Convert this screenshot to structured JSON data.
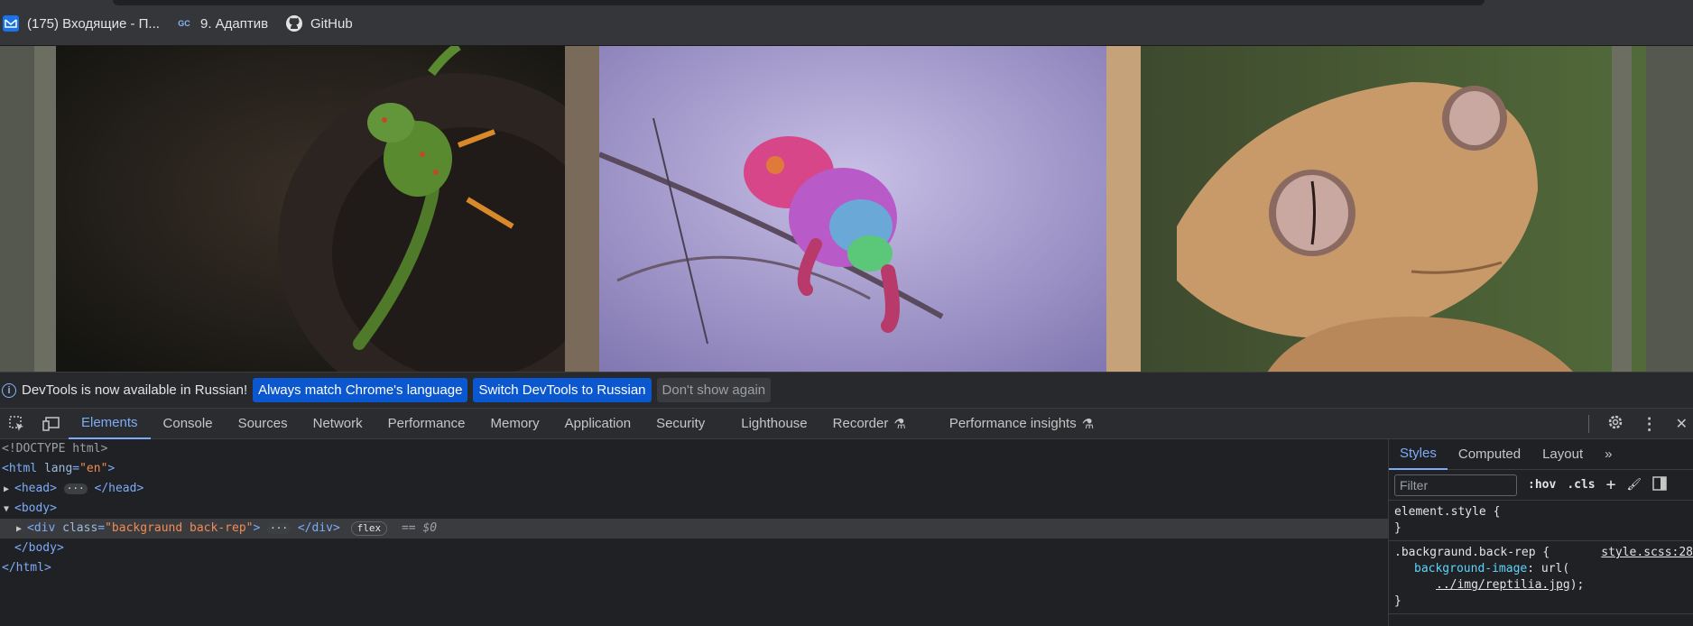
{
  "bookmarks": [
    {
      "label": "(175) Входящие - П...",
      "icon": "mail-icon"
    },
    {
      "label": "9. Адаптив",
      "icon": "gc-icon",
      "icon_text": "GC"
    },
    {
      "label": "GitHub",
      "icon": "github-icon"
    }
  ],
  "infobar": {
    "message": "DevTools is now available in Russian!",
    "btn_match": "Always match Chrome's language",
    "btn_switch": "Switch DevTools to Russian",
    "btn_dismiss": "Don't show again"
  },
  "tabs": [
    "Elements",
    "Console",
    "Sources",
    "Network",
    "Performance",
    "Memory",
    "Application",
    "Security",
    "Lighthouse",
    "Recorder",
    "Performance insights"
  ],
  "dom": {
    "doctype": "<!DOCTYPE html>",
    "html_open": "<html",
    "html_attr": "lang",
    "html_val": "\"en\"",
    "head_open": "<head>",
    "head_close": "</head>",
    "body_open": "<body>",
    "div_open": "<div",
    "div_attr": "class",
    "div_val": "\"backgraund back-rep\"",
    "div_close": "</div>",
    "flex_badge": "flex",
    "dollar": "== $0",
    "body_close": "</body>",
    "html_close": "</html>"
  },
  "styles": {
    "tabs": [
      "Styles",
      "Computed",
      "Layout"
    ],
    "filter_placeholder": "Filter",
    "hov": ":hov",
    "cls": ".cls",
    "element_style": "element.style {",
    "close_brace": "}",
    "rule_selector": ".backgraund.back-rep {",
    "rule_source": "style.scss:28",
    "rule_prop": "background-image",
    "rule_val_prefix": "url(",
    "rule_url": "../img/reptilia.jpg",
    "rule_val_suffix": ");"
  },
  "colors": {
    "accent": "#7cacf8",
    "button_primary": "#0b57d0"
  }
}
